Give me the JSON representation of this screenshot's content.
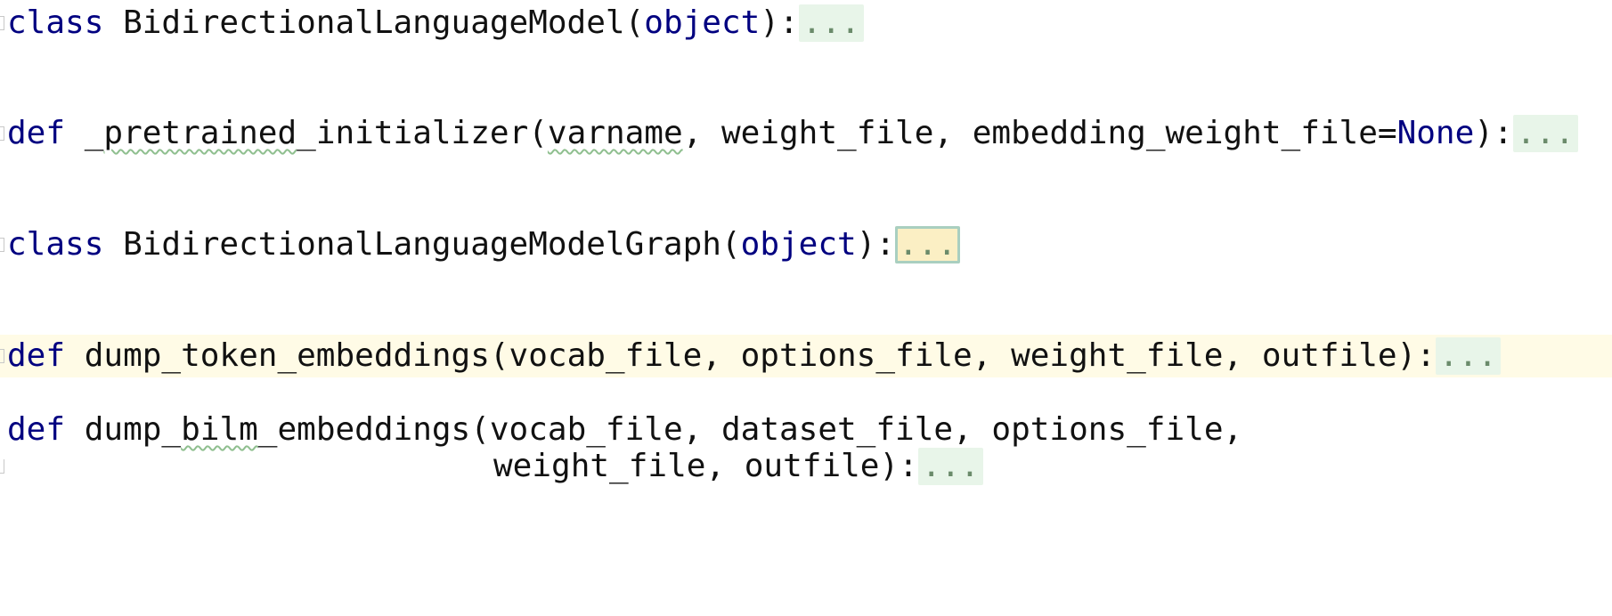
{
  "editor": {
    "colors": {
      "keyword": "#000080",
      "fold_bg": "#e8f5e9",
      "fold_active_bg": "#fbefc4",
      "current_line_bg": "#fffbe6"
    },
    "lines": [
      {
        "kw": "class",
        "name": "BidirectionalLanguageModel",
        "open": "(",
        "base": "object",
        "close": "):",
        "fold": "..."
      },
      {
        "kw": "def",
        "pre": "_",
        "squiggle_name": "pretrained",
        "post_name": "_initializer(",
        "squiggle_arg": "varname",
        "rest": ", weight_file, embedding_weight_file=",
        "none": "None",
        "close": "):",
        "fold": "..."
      },
      {
        "kw": "class",
        "name": "BidirectionalLanguageModelGraph",
        "open": "(",
        "base": "object",
        "close": "):",
        "fold": "..."
      },
      {
        "kw": "def",
        "signature": "dump_token_embeddings(vocab_file, options_file, weight_file, outfile):",
        "fold": "..."
      },
      {
        "kw": "def",
        "pre": "dump_",
        "squiggle_name": "bilm",
        "post_name": "_embeddings(vocab_file, dataset_file, options_file,",
        "continuation": "weight_file, outfile):",
        "fold": "..."
      }
    ]
  }
}
